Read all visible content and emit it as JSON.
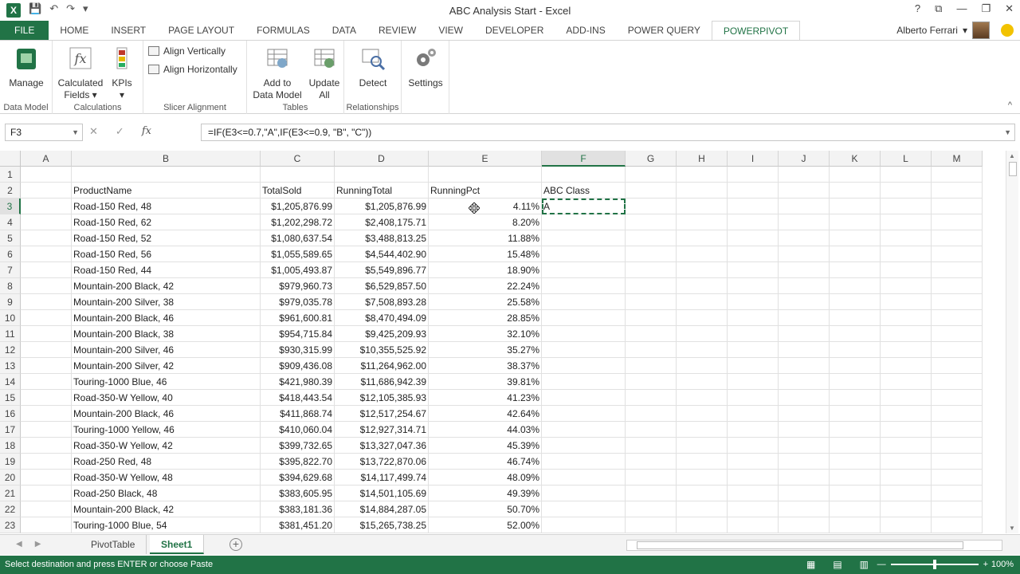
{
  "window": {
    "title": "ABC Analysis Start - Excel",
    "help": "?",
    "restore": "⧉",
    "minimize": "—",
    "maximize": "❐",
    "close": "✕"
  },
  "qat": {
    "save": "💾",
    "undo": "↶",
    "redo": "↷",
    "more": "▾"
  },
  "tabs": [
    "FILE",
    "HOME",
    "INSERT",
    "PAGE LAYOUT",
    "FORMULAS",
    "DATA",
    "REVIEW",
    "VIEW",
    "DEVELOPER",
    "ADD-INS",
    "POWER QUERY",
    "POWERPIVOT"
  ],
  "active_tab": "POWERPIVOT",
  "user": {
    "name": "Alberto Ferrari",
    "dropdown": "▾"
  },
  "ribbon": {
    "manage": "Manage",
    "calculated_fields_1": "Calculated",
    "calculated_fields_2": "Fields ▾",
    "kpis_1": "KPIs",
    "kpis_2": "▾",
    "align_vertically": "Align Vertically",
    "align_horizontally": "Align Horizontally",
    "add_to_data_model_1": "Add to",
    "add_to_data_model_2": "Data Model",
    "update_all_1": "Update",
    "update_all_2": "All",
    "detect": "Detect",
    "settings": "Settings",
    "groups": {
      "data_model": "Data Model",
      "calculations": "Calculations",
      "slicer_alignment": "Slicer Alignment",
      "tables": "Tables",
      "relationships": "Relationships"
    },
    "collapse": "^"
  },
  "formula_bar": {
    "name_box": "F3",
    "cancel": "✕",
    "enter": "✓",
    "fx": "fx",
    "formula": "=IF(E3<=0.7,\"A\",IF(E3<=0.9, \"B\", \"C\"))"
  },
  "columns": [
    "A",
    "B",
    "C",
    "D",
    "E",
    "F",
    "G",
    "H",
    "I",
    "J",
    "K",
    "L",
    "M"
  ],
  "headers": {
    "B": "ProductName",
    "C": "TotalSold",
    "D": "RunningTotal",
    "E": "RunningPct",
    "F": "ABC Class"
  },
  "rows": [
    {
      "n": 1
    },
    {
      "n": 2,
      "header": true
    },
    {
      "n": 3,
      "name": "Road-150 Red, 48",
      "sold": "$1,205,876.99",
      "total": "$1,205,876.99",
      "pct": "4.11%",
      "cls": "A"
    },
    {
      "n": 4,
      "name": "Road-150 Red, 62",
      "sold": "$1,202,298.72",
      "total": "$2,408,175.71",
      "pct": "8.20%"
    },
    {
      "n": 5,
      "name": "Road-150 Red, 52",
      "sold": "$1,080,637.54",
      "total": "$3,488,813.25",
      "pct": "11.88%"
    },
    {
      "n": 6,
      "name": "Road-150 Red, 56",
      "sold": "$1,055,589.65",
      "total": "$4,544,402.90",
      "pct": "15.48%"
    },
    {
      "n": 7,
      "name": "Road-150 Red, 44",
      "sold": "$1,005,493.87",
      "total": "$5,549,896.77",
      "pct": "18.90%"
    },
    {
      "n": 8,
      "name": "Mountain-200 Black, 42",
      "sold": "$979,960.73",
      "total": "$6,529,857.50",
      "pct": "22.24%"
    },
    {
      "n": 9,
      "name": "Mountain-200 Silver, 38",
      "sold": "$979,035.78",
      "total": "$7,508,893.28",
      "pct": "25.58%"
    },
    {
      "n": 10,
      "name": "Mountain-200 Black, 46",
      "sold": "$961,600.81",
      "total": "$8,470,494.09",
      "pct": "28.85%"
    },
    {
      "n": 11,
      "name": "Mountain-200 Black, 38",
      "sold": "$954,715.84",
      "total": "$9,425,209.93",
      "pct": "32.10%"
    },
    {
      "n": 12,
      "name": "Mountain-200 Silver, 46",
      "sold": "$930,315.99",
      "total": "$10,355,525.92",
      "pct": "35.27%"
    },
    {
      "n": 13,
      "name": "Mountain-200 Silver, 42",
      "sold": "$909,436.08",
      "total": "$11,264,962.00",
      "pct": "38.37%"
    },
    {
      "n": 14,
      "name": "Touring-1000 Blue, 46",
      "sold": "$421,980.39",
      "total": "$11,686,942.39",
      "pct": "39.81%"
    },
    {
      "n": 15,
      "name": "Road-350-W Yellow, 40",
      "sold": "$418,443.54",
      "total": "$12,105,385.93",
      "pct": "41.23%"
    },
    {
      "n": 16,
      "name": "Mountain-200 Black, 46",
      "sold": "$411,868.74",
      "total": "$12,517,254.67",
      "pct": "42.64%"
    },
    {
      "n": 17,
      "name": "Touring-1000 Yellow, 46",
      "sold": "$410,060.04",
      "total": "$12,927,314.71",
      "pct": "44.03%"
    },
    {
      "n": 18,
      "name": "Road-350-W Yellow, 42",
      "sold": "$399,732.65",
      "total": "$13,327,047.36",
      "pct": "45.39%"
    },
    {
      "n": 19,
      "name": "Road-250 Red, 48",
      "sold": "$395,822.70",
      "total": "$13,722,870.06",
      "pct": "46.74%"
    },
    {
      "n": 20,
      "name": "Road-350-W Yellow, 48",
      "sold": "$394,629.68",
      "total": "$14,117,499.74",
      "pct": "48.09%"
    },
    {
      "n": 21,
      "name": "Road-250 Black, 48",
      "sold": "$383,605.95",
      "total": "$14,501,105.69",
      "pct": "49.39%"
    },
    {
      "n": 22,
      "name": "Mountain-200 Black, 42",
      "sold": "$383,181.36",
      "total": "$14,884,287.05",
      "pct": "50.70%"
    },
    {
      "n": 23,
      "name": "Touring-1000 Blue, 54",
      "sold": "$381,451.20",
      "total": "$15,265,738.25",
      "pct": "52.00%"
    }
  ],
  "active_cell": "F3",
  "sheets": [
    "PivotTable",
    "Sheet1"
  ],
  "active_sheet": "Sheet1",
  "sheet_nav": {
    "prev": "◀",
    "next": "▶",
    "add": "+"
  },
  "status": {
    "message": "Select destination and press ENTER or choose Paste",
    "zoom_minus": "—",
    "zoom_plus": "+",
    "zoom": "100%",
    "zoom_level_pct": 100,
    "view_normal": "▦",
    "view_layout": "▤",
    "view_break": "▥"
  },
  "colors": {
    "accent": "#217346"
  }
}
